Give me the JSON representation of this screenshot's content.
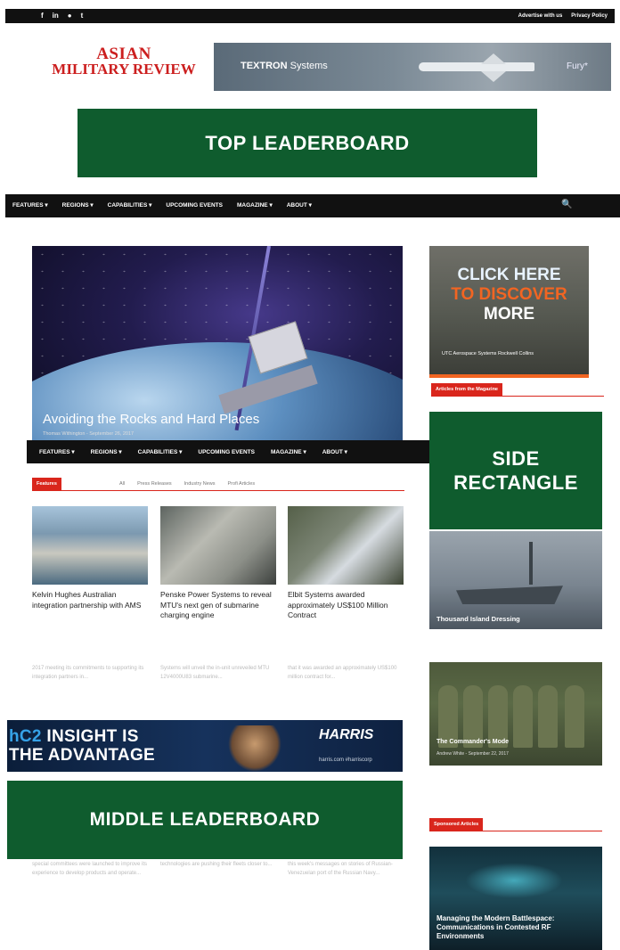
{
  "topbar": {
    "social_icons": [
      "f",
      "in",
      "●",
      "t"
    ],
    "social_icon_names": [
      "facebook-icon",
      "linkedin-icon",
      "youtube-icon",
      "twitter-icon"
    ],
    "links": [
      "Advertise with us",
      "Privacy Policy"
    ]
  },
  "logo": {
    "line1": "ASIAN",
    "line2": "MILITARY REVIEW",
    "color": "#cc1f1f"
  },
  "top_banner": {
    "brand_bold": "TEXTRON",
    "brand_rest": " Systems",
    "product": "Fury*"
  },
  "placeholders": {
    "top": "TOP LEADERBOARD",
    "side": "SIDE RECTANGLE",
    "middle": "MIDDLE LEADERBOARD",
    "color": "#0f5c2e"
  },
  "main_nav": {
    "items": [
      "FEATURES ▾",
      "REGIONS ▾",
      "CAPABILITIES ▾",
      "UPCOMING EVENTS",
      "MAGAZINE ▾",
      "ABOUT ▾"
    ],
    "search_icon": "🔍"
  },
  "hero": {
    "title": "Avoiding the Rocks and Hard Places",
    "meta": "Thomas Withington  -  September 26, 2017"
  },
  "secondary_nav": {
    "items": [
      "FEATURES ▾",
      "REGIONS ▾",
      "CAPABILITIES ▾",
      "UPCOMING EVENTS",
      "MAGAZINE ▾",
      "ABOUT ▾"
    ]
  },
  "side_ad": {
    "cta_line1": "CLICK HERE",
    "cta_line2": "TO DISCOVER",
    "cta_line3": "MORE",
    "logos": "UTC Aerospace Systems     Rockwell Collins",
    "accent": "#f26522"
  },
  "sections": {
    "magazine_label": "Articles from the Magazine",
    "features_label": "Features",
    "sponsored_label": "Sponsored Articles",
    "accent": "#d9261c"
  },
  "filters": [
    "All",
    "Press Releases",
    "Industry News",
    "Profi Articles"
  ],
  "cards": [
    {
      "title": "Kelvin Hughes Australian integration partnership with AMS",
      "excerpt": "2017 meeting its commitments to supporting its integration partners in..."
    },
    {
      "title": "Penske Power Systems to reveal MTU's next gen of submarine charging engine",
      "excerpt": "Systems will unveil the in-unit unreveiled MTU 12V4000U83 submarine..."
    },
    {
      "title": "Elbit Systems awarded approximately US$100 Million Contract",
      "excerpt": "that it was awarded an approximately US$100 million contract for..."
    }
  ],
  "side_stories": [
    {
      "title": "Thousand Island Dressing"
    },
    {
      "title": "The Commander's Mode",
      "meta": "Andrew White  -  September 22, 2017"
    }
  ],
  "harris_ad": {
    "slogan_part1": "hC2",
    "slogan_part2": " INSIGHT IS",
    "slogan_line2": "THE ADVANTAGE",
    "brand": "HARRIS",
    "web": "harris.com  #harriscorp"
  },
  "lower_excerpts": [
    "special committees were launched to improve its experience to develop products and operate...",
    "technologies are pushing their fleets closer to...",
    "this week's messages on stories of Russian-Venezuelan port of the Russian Navy..."
  ],
  "sponsored_story": {
    "title": "Managing the Modern Battlespace: Communications in Contested RF Environments"
  }
}
